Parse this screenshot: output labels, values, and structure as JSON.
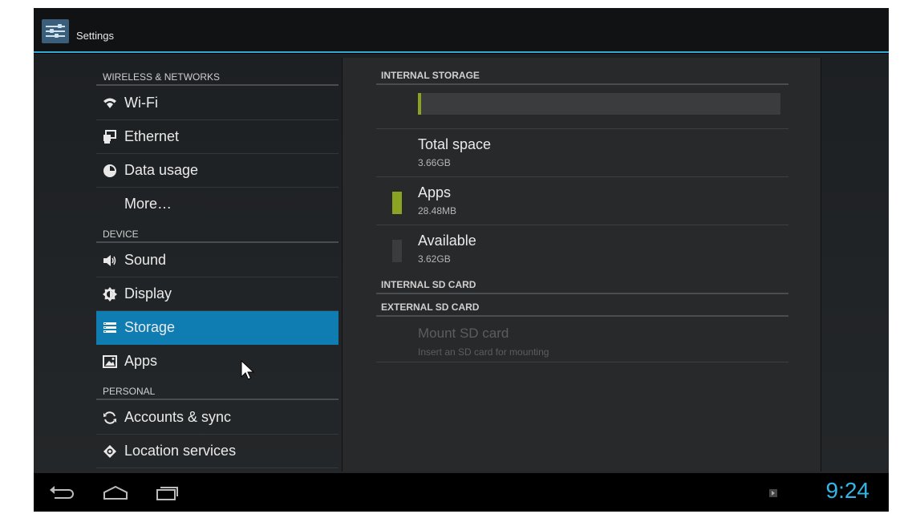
{
  "app": {
    "title": "Settings"
  },
  "sidebar": {
    "sections": [
      {
        "header": "WIRELESS & NETWORKS",
        "items": [
          {
            "label": "Wi-Fi",
            "icon": "wifi-icon"
          },
          {
            "label": "Ethernet",
            "icon": "ethernet-icon"
          },
          {
            "label": "Data usage",
            "icon": "data-usage-icon"
          },
          {
            "label": "More…",
            "icon": ""
          }
        ]
      },
      {
        "header": "DEVICE",
        "items": [
          {
            "label": "Sound",
            "icon": "speaker-icon"
          },
          {
            "label": "Display",
            "icon": "brightness-icon"
          },
          {
            "label": "Storage",
            "icon": "storage-icon",
            "selected": true
          },
          {
            "label": "Apps",
            "icon": "apps-icon"
          }
        ]
      },
      {
        "header": "PERSONAL",
        "items": [
          {
            "label": "Accounts & sync",
            "icon": "sync-icon"
          },
          {
            "label": "Location services",
            "icon": "location-icon"
          }
        ]
      }
    ]
  },
  "storage": {
    "internal_header": "INTERNAL STORAGE",
    "apps_fraction": 0.008,
    "total_label": "Total space",
    "total_value": "3.66GB",
    "apps_label": "Apps",
    "apps_value": "28.48MB",
    "available_label": "Available",
    "available_value": "3.62GB",
    "sd_internal_header": "INTERNAL SD CARD",
    "sd_external_header": "EXTERNAL SD CARD",
    "mount_label": "Mount SD card",
    "mount_sub": "Insert an SD card for mounting",
    "colors": {
      "apps": "#8aa322",
      "available": "#3a3c3e",
      "accent": "#33b5e5",
      "selected": "#0f7db2"
    }
  },
  "navbar": {
    "clock": "9:24",
    "buttons": [
      "back-icon",
      "home-icon",
      "recent-apps-icon"
    ]
  }
}
